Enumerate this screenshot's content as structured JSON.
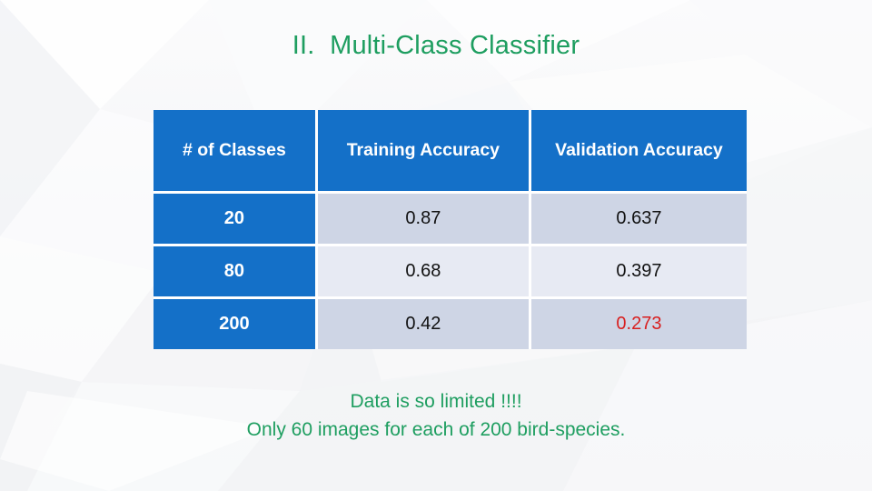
{
  "slide": {
    "title": "II.  Multi-Class Classifier",
    "title_color": "#1e9e60",
    "background_color": "#f4f5f7"
  },
  "table": {
    "header_background": "#1470c8",
    "header_text_color": "#ffffff",
    "row_shade_dark": "#ced5e5",
    "row_shade_light": "#e7eaf3",
    "alert_color": "#d81f1f",
    "columns": [
      "# of\nClasses",
      "Training\nAccuracy",
      "Validation\nAccuracy"
    ],
    "columns_flat": [
      "# of Classes",
      "Training Accuracy",
      "Validation Accuracy"
    ],
    "rows": [
      {
        "classes": "20",
        "training_accuracy": "0.87",
        "validation_accuracy": "0.637",
        "validation_highlighted": false
      },
      {
        "classes": "80",
        "training_accuracy": "0.68",
        "validation_accuracy": "0.397",
        "validation_highlighted": false
      },
      {
        "classes": "200",
        "training_accuracy": "0.42",
        "validation_accuracy": "0.273",
        "validation_highlighted": true
      }
    ]
  },
  "caption": {
    "line1": "Data is so limited !!!!",
    "line2": "Only 60 images for each of 200 bird-species.",
    "color": "#1e9e60"
  },
  "chart_data": {
    "type": "table",
    "title": "II.  Multi-Class Classifier",
    "columns": [
      "# of Classes",
      "Training Accuracy",
      "Validation Accuracy"
    ],
    "values": [
      [
        20,
        0.87,
        0.637
      ],
      [
        80,
        0.68,
        0.397
      ],
      [
        200,
        0.42,
        0.273
      ]
    ],
    "annotations": [
      "Data is so limited !!!!",
      "Only 60 images for each of 200 bird-species."
    ],
    "highlighted_cells": [
      {
        "row": 2,
        "column": "Validation Accuracy",
        "color": "#d81f1f"
      }
    ]
  }
}
